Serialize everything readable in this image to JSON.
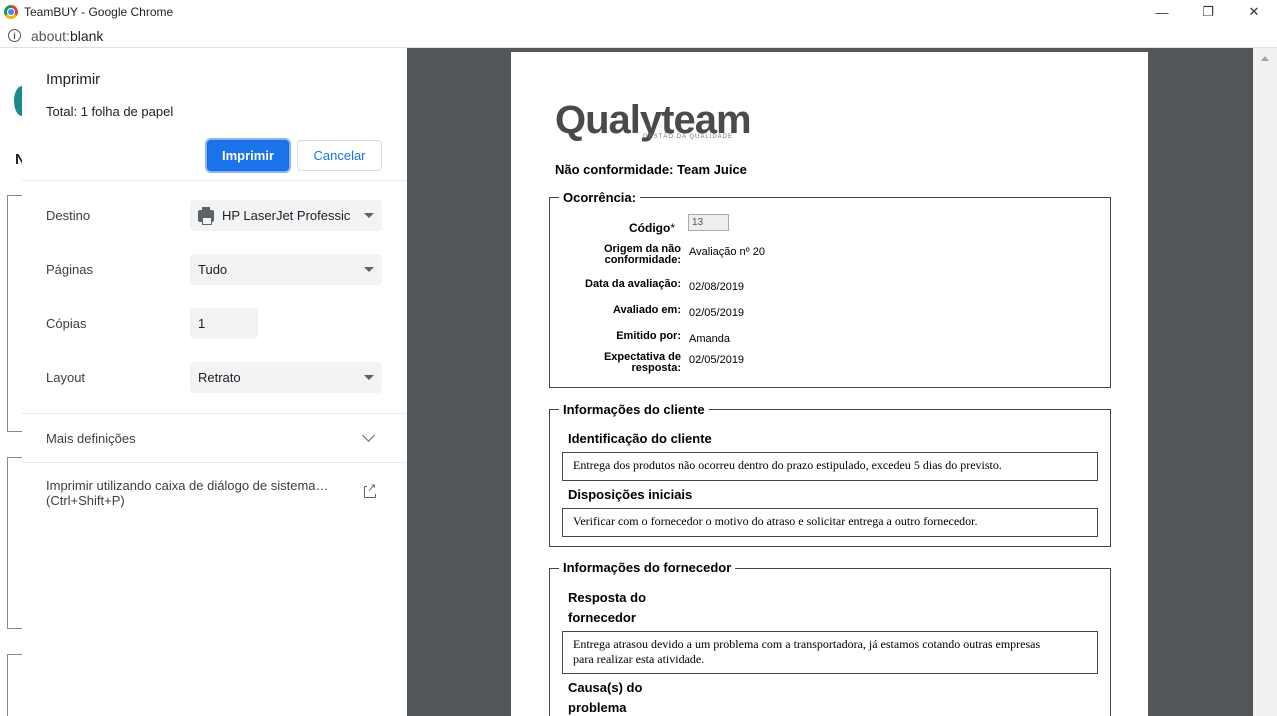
{
  "window": {
    "title": "TeamBUY - Google Chrome",
    "minimize": "—",
    "restore": "❐",
    "close": "✕"
  },
  "address": {
    "scheme": "about:",
    "host": "blank"
  },
  "print_panel": {
    "heading": "Imprimir",
    "total_label": "Total: ",
    "total_value": "1 folha de papel",
    "print_button": "Imprimir",
    "cancel_button": "Cancelar",
    "destination_label": "Destino",
    "destination_value": "HP LaserJet Professic",
    "pages_label": "Páginas",
    "pages_value": "Tudo",
    "copies_label": "Cópias",
    "copies_value": "1",
    "layout_label": "Layout",
    "layout_value": "Retrato",
    "more_settings": "Mais definições",
    "system_dialog_line1": "Imprimir utilizando caixa de diálogo de sistema…",
    "system_dialog_line2": "(Ctrl+Shift+P)"
  },
  "background_page": {
    "letter": "N"
  },
  "document": {
    "logo": "Qualyteam",
    "logo_sub": "GESTÃO DA QUALIDADE",
    "title": "Não conformidade: Team Juice",
    "occurrence": {
      "legend": "Ocorrência:",
      "codigo_label": "Código",
      "codigo_required": "*",
      "codigo_value": "13",
      "origem_label_1": "Origem da não",
      "origem_label_2": "conformidade:",
      "origem_value": "Avaliação nº 20",
      "data_label": "Data da avaliação:",
      "data_value": "02/08/2019",
      "avaliado_label": "Avaliado em:",
      "avaliado_value": "02/05/2019",
      "emitido_label": "Emitido por:",
      "emitido_value": "Amanda",
      "expectativa_label_1": "Expectativa de",
      "expectativa_label_2": "resposta:",
      "expectativa_value": "02/05/2019"
    },
    "client": {
      "legend": "Informações do cliente",
      "identificacao_heading": "Identificação do cliente",
      "identificacao_text": "Entrega dos produtos não ocorreu dentro do prazo estipulado, excedeu 5 dias do previsto.",
      "disposicoes_heading": "Disposições iniciais",
      "disposicoes_text": "Verificar com o fornecedor o motivo do atraso e solicitar entrega a outro fornecedor."
    },
    "supplier": {
      "legend": "Informações do fornecedor",
      "resposta_heading_1": "Resposta do",
      "resposta_heading_2": "fornecedor",
      "resposta_text_1": "Entrega atrasou devido a um problema com a transportadora, já estamos cotando outras empresas",
      "resposta_text_2": "para realizar esta atividade.",
      "causas_heading_1": "Causa(s) do",
      "causas_heading_2": "problema"
    }
  },
  "colors": {
    "primary_button": "#1a73e8",
    "preview_background": "#525659",
    "select_background": "#f1f3f4"
  }
}
